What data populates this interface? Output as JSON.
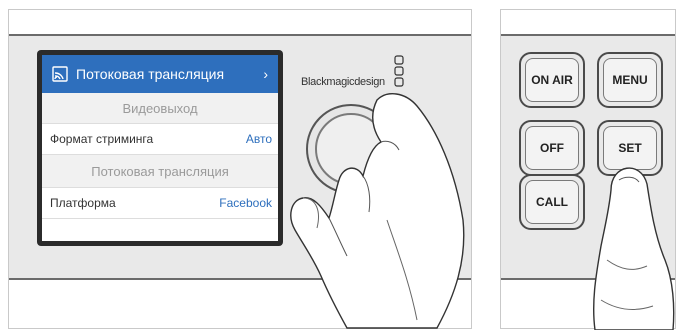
{
  "lcd": {
    "header_title": "Потоковая трансляция",
    "header_icon": "wifi-cast-icon",
    "header_arrow": "›",
    "section_video": "Видеовыход",
    "stream_format_label": "Формат стриминга",
    "stream_format_value": "Авто",
    "section_stream": "Потоковая трансляция",
    "platform_label": "Платформа",
    "platform_value": "Facebook",
    "accent": "#2e6fbd"
  },
  "device": {
    "brand": "Blackmagicdesign"
  },
  "keys": {
    "on_air": "ON AIR",
    "menu": "MENU",
    "off": "OFF",
    "set": "SET",
    "call": "CALL"
  }
}
